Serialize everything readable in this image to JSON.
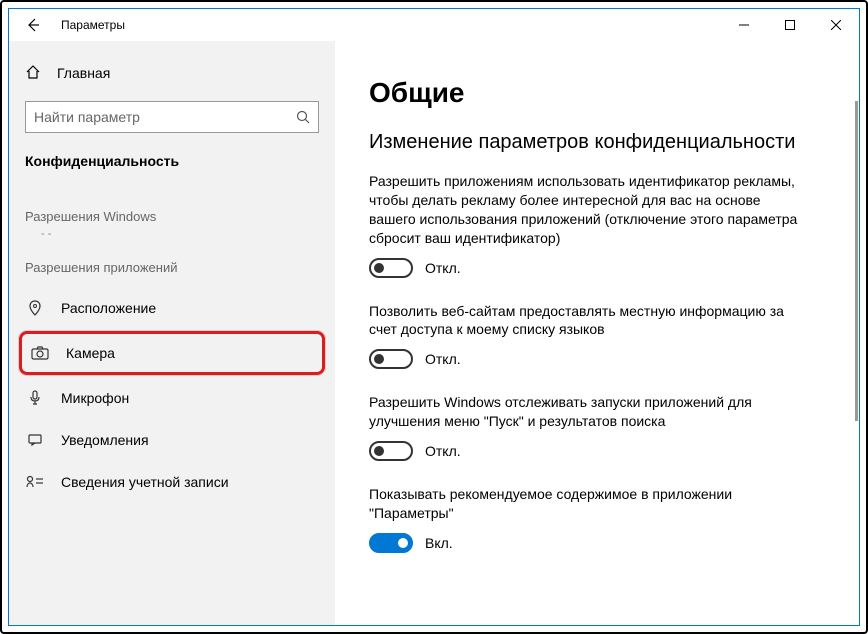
{
  "window": {
    "title": "Параметры"
  },
  "sidebar": {
    "home_label": "Главная",
    "search_placeholder": "Найти параметр",
    "section_label": "Конфиденциальность",
    "group1_label": "Разрешения Windows",
    "group1_sub": "- -",
    "group2_label": "Разрешения приложений",
    "items": [
      {
        "label": "Расположение"
      },
      {
        "label": "Камера"
      },
      {
        "label": "Микрофон"
      },
      {
        "label": "Уведомления"
      },
      {
        "label": "Сведения учетной записи"
      }
    ]
  },
  "main": {
    "page_title": "Общие",
    "section_title": "Изменение параметров конфиденциальности",
    "settings": [
      {
        "desc": "Разрешить приложениям использовать идентификатор рекламы, чтобы делать рекламу более интересной для вас на основе вашего использования приложений (отключение этого параметра сбросит ваш идентификатор)",
        "state_label": "Откл.",
        "on": false
      },
      {
        "desc": "Позволить веб-сайтам предоставлять местную информацию за счет доступа к моему списку языков",
        "state_label": "Откл.",
        "on": false
      },
      {
        "desc": "Разрешить Windows отслеживать запуски приложений для улучшения меню \"Пуск\" и результатов поиска",
        "state_label": "Откл.",
        "on": false
      },
      {
        "desc": "Показывать рекомендуемое содержимое в приложении \"Параметры\"",
        "state_label": "Вкл.",
        "on": true
      }
    ]
  }
}
